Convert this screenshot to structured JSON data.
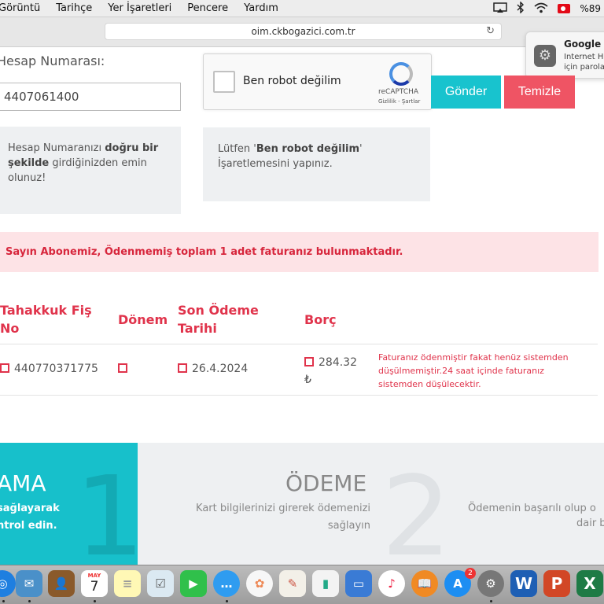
{
  "menubar": {
    "items": [
      "Görüntü",
      "Tarihçe",
      "Yer İşaretleri",
      "Pencere",
      "Yardım"
    ],
    "battery": "%89"
  },
  "browser": {
    "url": "oim.ckbogazici.com.tr"
  },
  "notification": {
    "title": "Google P",
    "line1": "Internet H",
    "line2": "için parola"
  },
  "form": {
    "account_label": "Hesap Numarası:",
    "account_value": "4407061400",
    "captcha": {
      "label": "Ben robot değilim",
      "brand": "reCAPTCHA",
      "links": "Gizlilik - Şartlar"
    },
    "send_label": "Gönder",
    "clear_label": "Temizle"
  },
  "info1": {
    "p1": "Hesap Numaranızı ",
    "b1": "doğru bir şekilde",
    "p2": " girdiğinizden emin olunuz!"
  },
  "info2": {
    "p1": "Lütfen '",
    "b1": "Ben robot değilim",
    "p2": "' İşaretlemesini yapınız."
  },
  "alert": "Sayın Abonemiz, Ödenmemiş toplam 1 adet faturanız bulunmaktadır.",
  "table": {
    "headers": [
      "Tahakkuk Fiş No",
      "Dönem",
      "Son Ödeme Tarihi",
      "Borç"
    ],
    "row": {
      "fis": "440770371775",
      "donem": "",
      "tarih": "26.4.2024",
      "borc": "284.32",
      "currency": "₺",
      "note": "Faturanız ödenmiştir fakat henüz sistemden düşülmemiştir.24 saat içinde faturanız sistemden düşülecektir."
    }
  },
  "steps": [
    {
      "num": "1",
      "title": "AMA",
      "line1": "sağlayarak",
      "line2": "ntrol edin."
    },
    {
      "num": "2",
      "title": "ÖDEME",
      "line1": "Kart bilgilerinizi girerek ödemenizi",
      "line2": "sağlayın",
      "line3": "Ödemenin başarılı olup o",
      "line4": "dair b"
    }
  ],
  "dock": {
    "calendar_month": "MAY",
    "calendar_day": "7",
    "badge": "2"
  },
  "colors": {
    "turquoise": "#18c3ce",
    "red": "#ef5464",
    "text_red": "#e0334b",
    "alert_bg": "#fde3e6"
  }
}
